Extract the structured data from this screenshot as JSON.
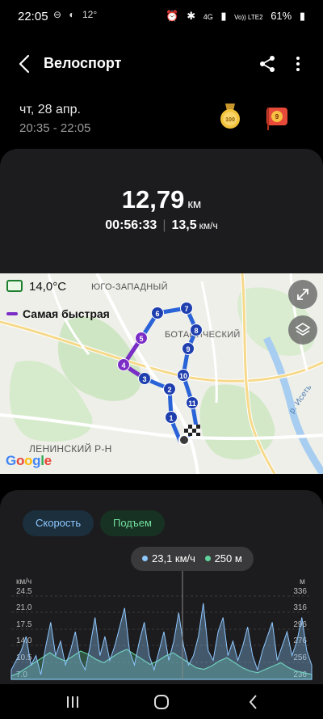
{
  "status_bar": {
    "time": "22:05",
    "temperature": "12°",
    "network": "4G",
    "carrier": "Vo)) LTE2",
    "battery": "61%"
  },
  "header": {
    "title": "Велоспорт",
    "back_icon": "arrow-back-icon",
    "share_icon": "share-icon",
    "more_icon": "more-vertical-icon"
  },
  "workout": {
    "date": "чт, 28 апр.",
    "time_range": "20:35 - 22:05",
    "badges": [
      "medal-100-icon",
      "flag-badge-icon"
    ]
  },
  "summary": {
    "distance_value": "12,79",
    "distance_unit": "км",
    "duration": "00:56:33",
    "avg_speed_value": "13,5",
    "avg_speed_unit": "км/ч"
  },
  "map": {
    "weather": "14,0°C",
    "legend_fastest": "Самая быстрая",
    "labels": {
      "district_sw": "ЮГО-ЗАПАДНЫЙ",
      "district_bot": "БОТАНИЧЕСКИЙ",
      "district_len": "ЛЕНИНСКИЙ Р-Н",
      "river": "р. Исеть"
    },
    "waypoints": [
      "1",
      "2",
      "3",
      "4",
      "5",
      "6",
      "7",
      "8",
      "9",
      "10",
      "11"
    ],
    "fullscreen_icon": "expand-icon",
    "layers_icon": "layers-icon",
    "attribution": "Google"
  },
  "chart": {
    "tabs": [
      "Скорость",
      "Подъем"
    ],
    "tooltip_speed": "23,1 км/ч",
    "tooltip_elevation": "250 м",
    "left_unit": "км/ч",
    "right_unit": "м",
    "colors": {
      "speed": "#8fc8ff",
      "elevation": "#5fd39a"
    }
  },
  "chart_data": {
    "type": "area",
    "title": "",
    "ylabel": "км/ч",
    "y2label": "м",
    "y_ticks": [
      "24.5",
      "21.0",
      "17.5",
      "14.0",
      "10.5",
      "7.0"
    ],
    "y2_ticks": [
      "336",
      "316",
      "296",
      "276",
      "256",
      "236"
    ],
    "ylim": [
      7.0,
      24.5
    ],
    "y2lim": [
      236,
      336
    ],
    "series": [
      {
        "name": "Скорость",
        "values": [
          9,
          11,
          13,
          16,
          10,
          12,
          8,
          14,
          19,
          12,
          15,
          10,
          13,
          17,
          11,
          9,
          14,
          20,
          12,
          16,
          11,
          14,
          18,
          22,
          13,
          10,
          15,
          19,
          12,
          9,
          13,
          17,
          11,
          15,
          21,
          14,
          10,
          12,
          16,
          23,
          13,
          11,
          17,
          20,
          12,
          15,
          11,
          14,
          18,
          12,
          9,
          13,
          16,
          19,
          11,
          14,
          17,
          12,
          15,
          20,
          13,
          10
        ]
      },
      {
        "name": "Подъем",
        "values": [
          240,
          244,
          250,
          256,
          262,
          268,
          262,
          258,
          264,
          270,
          266,
          260,
          256,
          262,
          268,
          272,
          266,
          260,
          254,
          258,
          264,
          268,
          262,
          256,
          250,
          248,
          252,
          258,
          262,
          256,
          250,
          246,
          244,
          248,
          252,
          256,
          250,
          246,
          244,
          242
        ]
      }
    ]
  },
  "nav": {
    "recents_icon": "recents-icon",
    "home_icon": "home-icon",
    "back_icon": "nav-back-icon"
  }
}
